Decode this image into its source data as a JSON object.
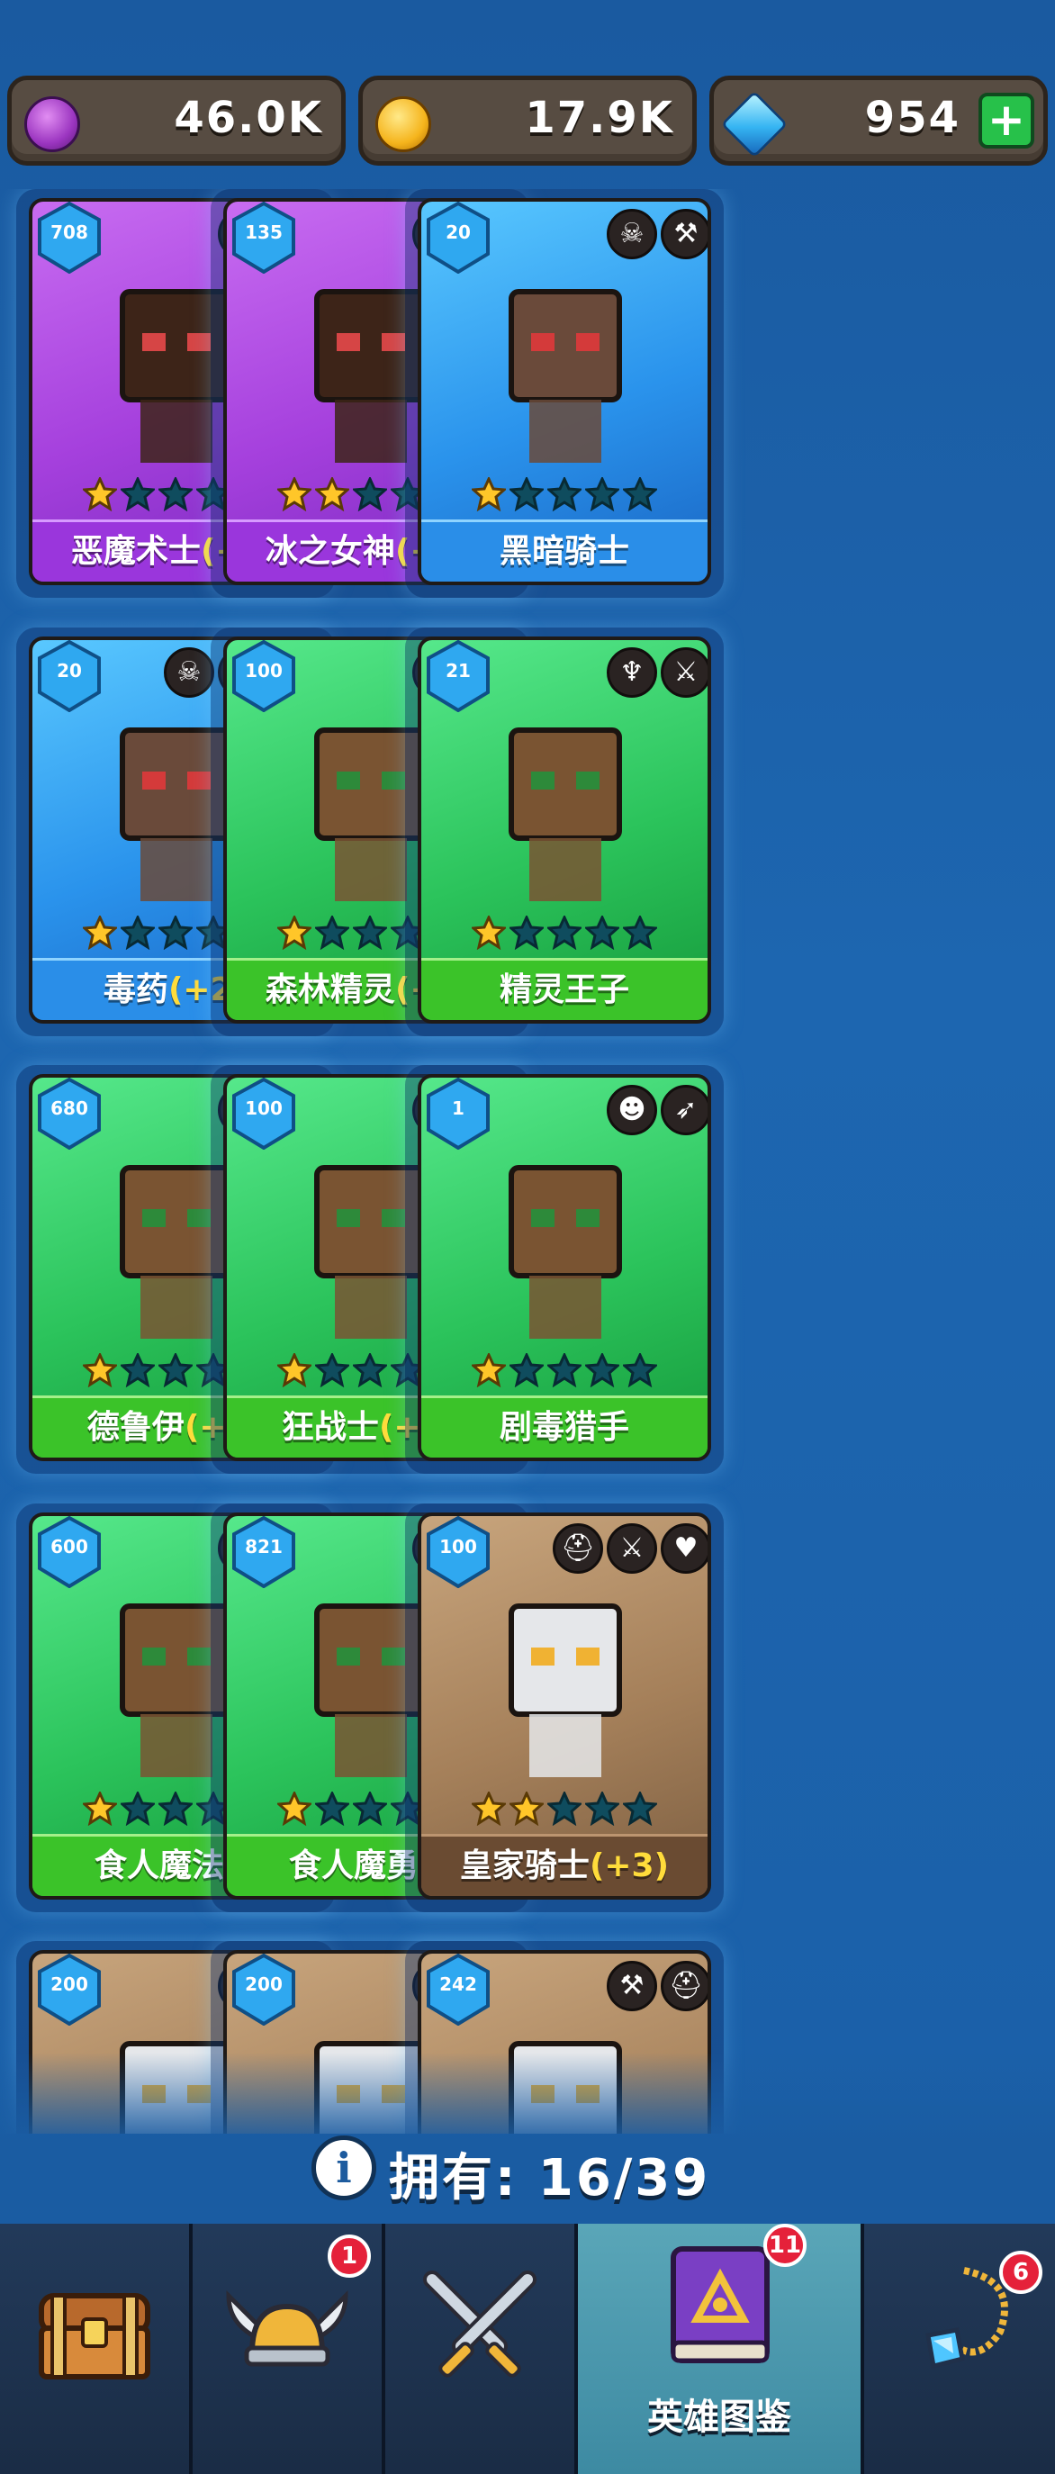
{
  "currencies": [
    {
      "icon": "purple-coin-icon",
      "value": "46.0K"
    },
    {
      "icon": "gold-coin-icon",
      "value": "17.9K"
    },
    {
      "icon": "gem-icon",
      "value": "954",
      "add_label": "+"
    }
  ],
  "cards": [
    {
      "name": "恶魔术士",
      "bonus": "(+3)",
      "level": "708",
      "stars": 1,
      "color": "purple",
      "classes": [
        "☠",
        "⚘"
      ]
    },
    {
      "name": "冰之女神",
      "bonus": "(+3)",
      "level": "135",
      "stars": 2,
      "color": "purple",
      "classes": [
        "✥",
        "⚚"
      ]
    },
    {
      "name": "黑暗骑士",
      "bonus": "",
      "level": "20",
      "stars": 1,
      "color": "blue",
      "classes": [
        "☠",
        "⚒"
      ]
    },
    {
      "name": "毒药",
      "bonus": "(+2)",
      "level": "20",
      "stars": 1,
      "color": "blue",
      "classes": [
        "☠",
        "⚔",
        "♞"
      ]
    },
    {
      "name": "森林精灵",
      "bonus": "(+2)",
      "level": "100",
      "stars": 1,
      "color": "green",
      "classes": [
        "⚒",
        "♆"
      ]
    },
    {
      "name": "精灵王子",
      "bonus": "",
      "level": "21",
      "stars": 1,
      "color": "green",
      "classes": [
        "♆",
        "⚔"
      ]
    },
    {
      "name": "德鲁伊",
      "bonus": "(+2)",
      "level": "680",
      "stars": 1,
      "color": "green",
      "classes": [
        "♆",
        "⚔"
      ]
    },
    {
      "name": "狂战士",
      "bonus": "(+3)",
      "level": "100",
      "stars": 1,
      "color": "green",
      "classes": [
        "☻",
        "⚔"
      ]
    },
    {
      "name": "剧毒猎手",
      "bonus": "",
      "level": "1",
      "stars": 1,
      "color": "green",
      "classes": [
        "☻",
        "➶"
      ]
    },
    {
      "name": "食人魔法师",
      "bonus": "",
      "level": "600",
      "stars": 1,
      "color": "green",
      "classes": [
        "☻",
        "⚚"
      ]
    },
    {
      "name": "食人魔勇士",
      "bonus": "",
      "level": "821",
      "stars": 1,
      "color": "green",
      "classes": [
        "⚔",
        "☻"
      ]
    },
    {
      "name": "皇家骑士",
      "bonus": "(+3)",
      "level": "100",
      "stars": 2,
      "color": "tan",
      "classes": [
        "⛑",
        "⚔",
        "♥"
      ]
    },
    {
      "name": "",
      "bonus": "",
      "level": "200",
      "stars": 0,
      "color": "tan",
      "classes": [
        "⛑",
        "➶"
      ]
    },
    {
      "name": "",
      "bonus": "",
      "level": "200",
      "stars": 0,
      "color": "tan",
      "classes": [
        "⚚",
        "⛑"
      ]
    },
    {
      "name": "",
      "bonus": "",
      "level": "242",
      "stars": 0,
      "color": "tan",
      "classes": [
        "⚒",
        "⛑"
      ]
    }
  ],
  "owned": {
    "label": "拥有: 16/39"
  },
  "tabs": [
    {
      "id": "chest",
      "icon": "treasure-chest-icon",
      "label": "",
      "badge": "",
      "active": false
    },
    {
      "id": "heroes",
      "icon": "viking-helmet-icon",
      "label": "",
      "badge": "1",
      "active": false
    },
    {
      "id": "battle",
      "icon": "crossed-swords-icon",
      "label": "",
      "badge": "",
      "active": false
    },
    {
      "id": "codex",
      "icon": "hero-codex-book-icon",
      "label": "英雄图鉴",
      "badge": "11",
      "active": true
    },
    {
      "id": "amulet",
      "icon": "amulet-icon",
      "label": "",
      "badge": "6",
      "active": false
    }
  ]
}
